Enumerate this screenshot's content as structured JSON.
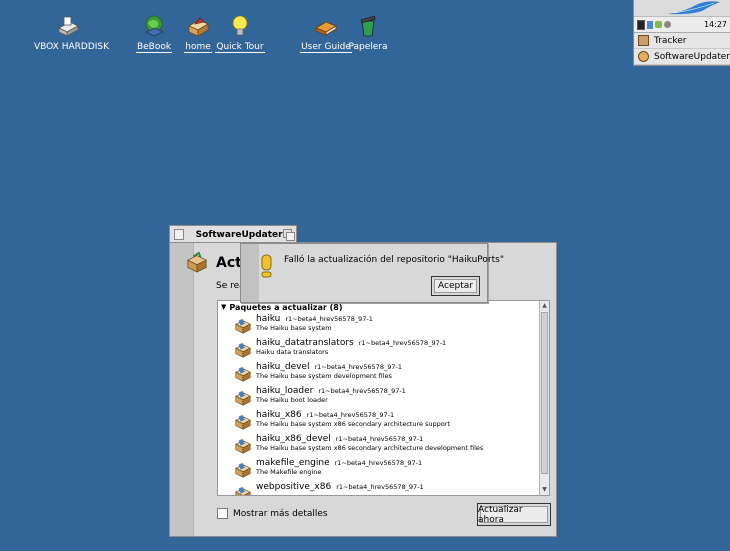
{
  "desktop": {
    "icons": [
      {
        "label": "VBOX HARDDISK",
        "icon": "harddisk-icon"
      },
      {
        "label": "BeBook",
        "icon": "bebook-icon"
      },
      {
        "label": "home",
        "icon": "home-folder-icon"
      },
      {
        "label": "Quick Tour",
        "icon": "lightbulb-icon"
      },
      {
        "label": "User Guide",
        "icon": "book-icon"
      },
      {
        "label": "Papelera",
        "icon": "trash-icon"
      }
    ]
  },
  "deskbar": {
    "clock": "14:27",
    "items": [
      {
        "label": "Tracker",
        "icon": "tracker-icon"
      },
      {
        "label": "SoftwareUpdater",
        "icon": "software-updater-icon"
      }
    ]
  },
  "window": {
    "title": "SoftwareUpdater",
    "heading": "Actu",
    "subtext": "Se real",
    "group_label": "Paquetes a actualizar (8)",
    "packages": [
      {
        "name": "haiku",
        "version": "r1~beta4_hrev56578_97-1",
        "description": "The Haiku base system"
      },
      {
        "name": "haiku_datatranslators",
        "version": "r1~beta4_hrev56578_97-1",
        "description": "Haiku data translators"
      },
      {
        "name": "haiku_devel",
        "version": "r1~beta4_hrev56578_97-1",
        "description": "The Haiku base system development files"
      },
      {
        "name": "haiku_loader",
        "version": "r1~beta4_hrev56578_97-1",
        "description": "The Haiku boot loader"
      },
      {
        "name": "haiku_x86",
        "version": "r1~beta4_hrev56578_97-1",
        "description": "The Haiku base system x86 secondary architecture support"
      },
      {
        "name": "haiku_x86_devel",
        "version": "r1~beta4_hrev56578_97-1",
        "description": "The Haiku base system x86 secondary architecture development files"
      },
      {
        "name": "makefile_engine",
        "version": "r1~beta4_hrev56578_97-1",
        "description": "The Makefile engine"
      },
      {
        "name": "webpositive_x86",
        "version": "r1~beta4_hrev56578_97-1",
        "description": ""
      }
    ],
    "show_details_label": "Mostrar más detalles",
    "update_button": "Actualizar ahora"
  },
  "alert": {
    "message": "Falló la actualización del repositorio \"HaikuPorts\"",
    "ok_button": "Aceptar"
  },
  "colors": {
    "desktop": "#336698",
    "panel": "#d8d8d8",
    "alert_icon": "#f2c12e"
  }
}
